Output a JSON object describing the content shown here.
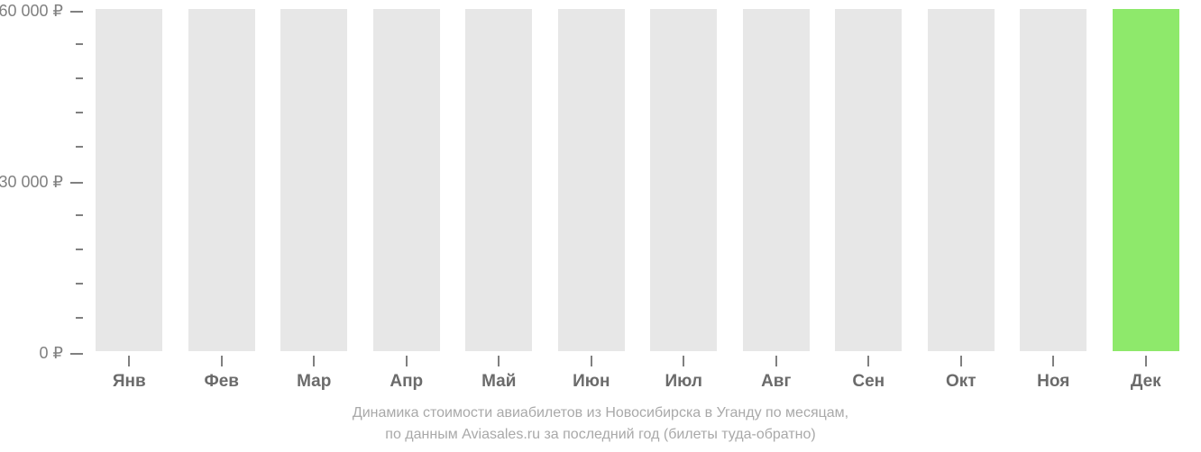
{
  "chart_data": {
    "type": "bar",
    "categories": [
      "Янв",
      "Фев",
      "Мар",
      "Апр",
      "Май",
      "Июн",
      "Июл",
      "Авг",
      "Сен",
      "Окт",
      "Ноя",
      "Дек"
    ],
    "values": [
      null,
      null,
      null,
      null,
      null,
      null,
      null,
      null,
      null,
      null,
      null,
      61000
    ],
    "title": "Динамика стоимости авиабилетов из Новосибирска в Уганду по месяцам,",
    "subtitle": "по данным Aviasales.ru за последний год (билеты туда-обратно)",
    "xlabel": "",
    "ylabel": "",
    "ylim": [
      0,
      61000
    ],
    "y_ticks_major": [
      0,
      30000,
      60000
    ],
    "y_tick_labels": [
      "0 ₽",
      "30 000 ₽",
      "60 000 ₽"
    ],
    "currency": "₽"
  },
  "layout": {
    "placeholder_bar_height_pct": 100,
    "data_bar_color": "#8ee96b",
    "placeholder_bar_color": "#e7e7e7"
  }
}
